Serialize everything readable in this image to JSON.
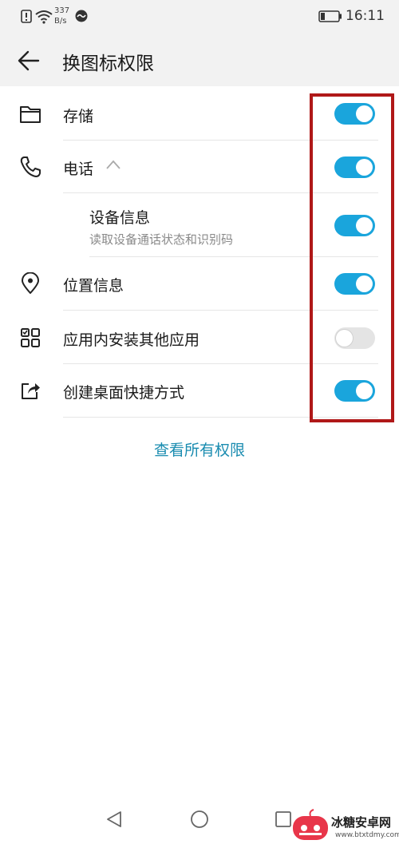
{
  "status_bar": {
    "speed_value": "337",
    "speed_unit": "B/s",
    "time": "16:11"
  },
  "header": {
    "title": "换图标权限"
  },
  "permissions": [
    {
      "label": "存储",
      "icon": "folder-icon",
      "enabled": true
    },
    {
      "label": "电话",
      "icon": "phone-icon",
      "enabled": true,
      "expanded": true
    },
    {
      "label": "设备信息",
      "sublabel": "读取设备通话状态和识别码",
      "enabled": true
    },
    {
      "label": "位置信息",
      "icon": "location-pin-icon",
      "enabled": true
    },
    {
      "label": "应用内安装其他应用",
      "icon": "apps-grid-icon",
      "enabled": false
    },
    {
      "label": "创建桌面快捷方式",
      "icon": "share-shortcut-icon",
      "enabled": true
    }
  ],
  "view_all_label": "查看所有权限",
  "watermark": {
    "name": "冰糖安卓网",
    "url": "www.btxtdmy.com"
  },
  "colors": {
    "toggle_on": "#1aa5dc",
    "toggle_off": "#e4e4e4",
    "highlight": "#b01818",
    "link": "#1a8cb0"
  }
}
